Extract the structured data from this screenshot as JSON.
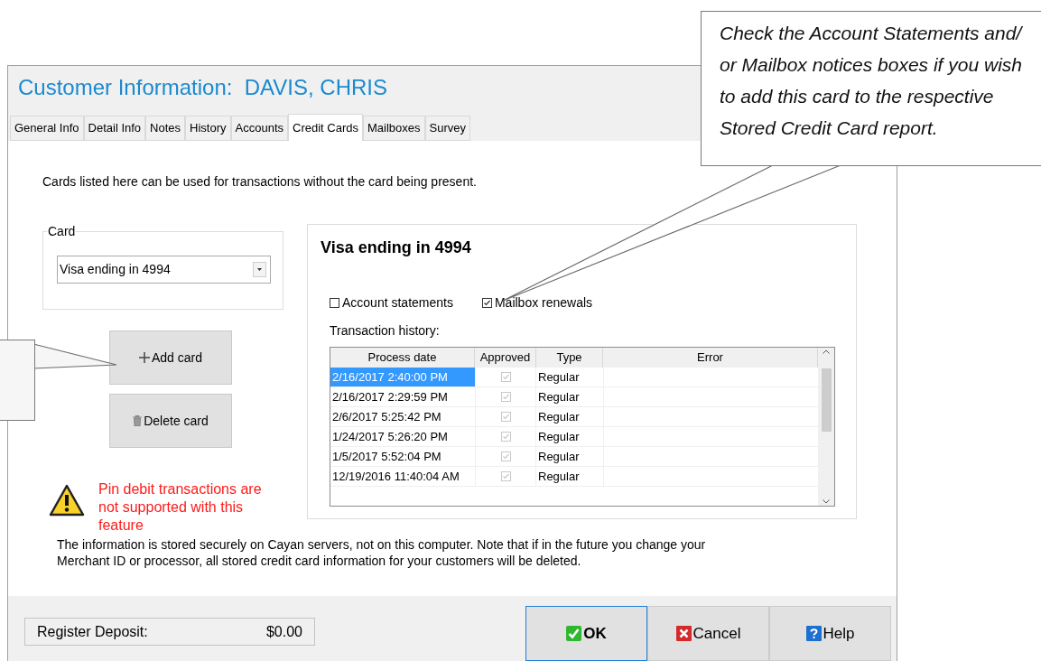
{
  "window": {
    "title": "Customer Information:  DAVIS, CHRIS"
  },
  "tabs": [
    {
      "label": "General Info",
      "selected": false
    },
    {
      "label": "Detail Info",
      "selected": false
    },
    {
      "label": "Notes",
      "selected": false
    },
    {
      "label": "History",
      "selected": false
    },
    {
      "label": "Accounts",
      "selected": false
    },
    {
      "label": "Credit Cards",
      "selected": true
    },
    {
      "label": "Mailboxes",
      "selected": false
    },
    {
      "label": "Survey",
      "selected": false
    }
  ],
  "intro": "Cards listed here can be used for transactions without the card being present.",
  "card_group": {
    "label": "Card",
    "value": "Visa ending in 4994"
  },
  "card_buttons": [
    {
      "label": "Add card",
      "kind": "add"
    },
    {
      "label": "Delete card",
      "kind": "delete"
    }
  ],
  "warning": "Pin debit transactions are not supported with this feature",
  "info": "The information is stored securely on Cayan servers, not on this computer. Note that if in the future you change your Merchant ID or processor, all stored credit card information for your customers will be deleted.",
  "detail": {
    "title": "Visa ending in 4994",
    "checkboxes": [
      {
        "label": "Account statements",
        "checked": false
      },
      {
        "label": "Mailbox renewals",
        "checked": true
      }
    ],
    "history_label": "Transaction history:",
    "columns": [
      "Process date",
      "Approved",
      "Type",
      "Error"
    ],
    "rows": [
      {
        "process_date": "2/16/2017 2:40:00 PM",
        "approved": true,
        "type": "Regular",
        "selected": true
      },
      {
        "process_date": "2/16/2017 2:29:59 PM",
        "approved": true,
        "type": "Regular",
        "selected": false
      },
      {
        "process_date": "2/6/2017 5:25:42 PM",
        "approved": true,
        "type": "Regular",
        "selected": false
      },
      {
        "process_date": "1/24/2017 5:26:20 PM",
        "approved": true,
        "type": "Regular",
        "selected": false
      },
      {
        "process_date": "1/5/2017 5:52:04 PM",
        "approved": true,
        "type": "Regular",
        "selected": false
      },
      {
        "process_date": "12/19/2016 11:40:04 AM",
        "approved": true,
        "type": "Regular",
        "selected": false
      }
    ]
  },
  "footer": {
    "register_label": "Register Deposit:",
    "register_value": "$0.00",
    "buttons": [
      {
        "label": "OK",
        "kind": "ok",
        "default": true
      },
      {
        "label": "Cancel",
        "kind": "cancel",
        "default": false
      },
      {
        "label": "Help",
        "kind": "help",
        "default": false
      }
    ]
  },
  "callout": {
    "text": "Check the Account Statements and/ or Mailbox notices boxes if you wish to add this card to the respective Stored Credit Card report."
  }
}
